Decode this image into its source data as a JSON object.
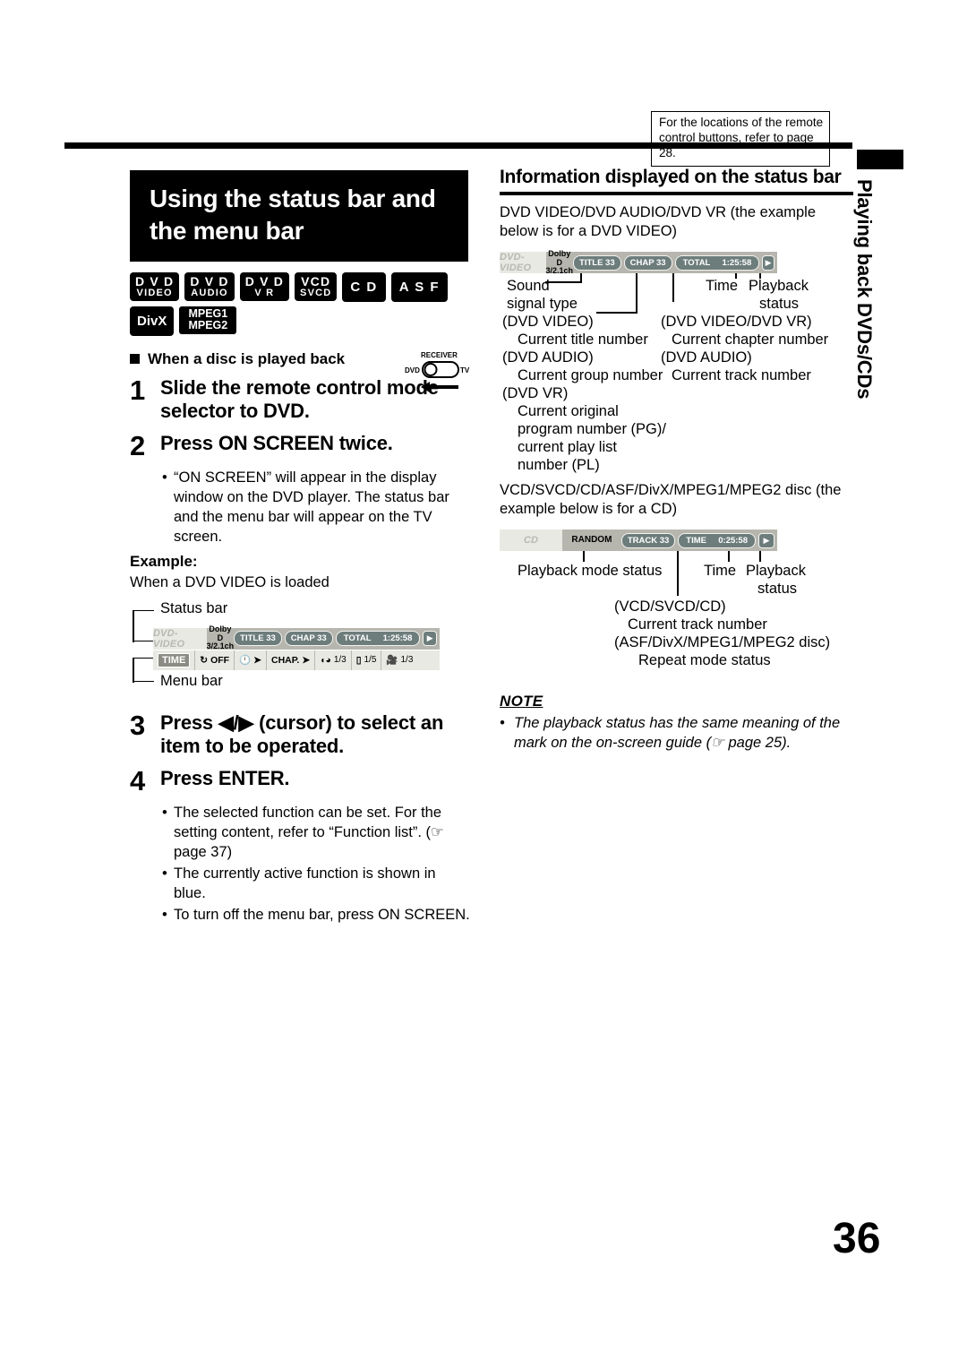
{
  "remote_note": "For the locations of the remote control buttons, refer to page 28.",
  "side_tab": {
    "label": "Playing back DVDs/CDs"
  },
  "page_number": "36",
  "left": {
    "title": "Using the status bar and the menu bar",
    "logos": [
      {
        "line1": "D V D",
        "line2": "VIDEO"
      },
      {
        "line1": "D V D",
        "line2": "AUDIO"
      },
      {
        "line1": "D V D",
        "line2": "V R"
      },
      {
        "line1": "VCD",
        "line2": "SVCD"
      },
      {
        "line1": "C D",
        "line2": ""
      },
      {
        "line1": "A S F",
        "line2": ""
      },
      {
        "line1": "DivX",
        "line2": ""
      },
      {
        "line1": "MPEG1",
        "line2": "MPEG2"
      }
    ],
    "subhead": "When a disc is played back",
    "steps": [
      {
        "num": "1",
        "text": "Slide the remote control mode selector to DVD."
      },
      {
        "num": "2",
        "text": "Press ON SCREEN twice."
      },
      {
        "num": "3",
        "text": "Press ◀/▶ (cursor) to select an item to be operated."
      },
      {
        "num": "4",
        "text": "Press ENTER."
      }
    ],
    "step2_bullets": [
      "“ON SCREEN” will appear in the display window on the DVD player. The status bar and the menu bar will appear on the TV screen."
    ],
    "example_label": "Example:",
    "example_text": "When a DVD VIDEO is loaded",
    "step4_bullets": [
      "The selected function can be set. For the setting content, refer to “Function list”. (☞ page 37)",
      "The currently active function is shown in blue.",
      "To turn off the menu bar, press ON SCREEN."
    ],
    "figure": {
      "status_bar_label": "Status bar",
      "menu_bar_label": "Menu bar",
      "status_bar": {
        "disc": "DVD-VIDEO",
        "sound_line1": "Dolby D",
        "sound_line2": "3/2.1ch",
        "chips": [
          "TITLE 33",
          "CHAP 33"
        ],
        "total_label": "TOTAL",
        "total_value": "1:25:58",
        "play_icon": "play-icon"
      },
      "menu_bar": {
        "time_label": "TIME",
        "repeat_label": "OFF",
        "chapter_label": "CHAP.",
        "audio_value": "1/3",
        "subtitle_value": "1/5",
        "angle_value": "1/3"
      }
    },
    "remote_selector": {
      "top": "RECEIVER",
      "left": "DVD",
      "right": "TV"
    }
  },
  "right": {
    "heading": "Information displayed on the status bar",
    "intro": "DVD VIDEO/DVD AUDIO/DVD VR (the example below is for a DVD VIDEO)",
    "dvd_status_bar": {
      "disc": "DVD-VIDEO",
      "sound_line1": "Dolby D",
      "sound_line2": "3/2.1ch",
      "chips": [
        "TITLE 33",
        "CHAP 33"
      ],
      "total_label": "TOTAL",
      "total_value": "1:25:58",
      "play_icon": "play-icon"
    },
    "dvd_callouts": {
      "sound_1": "Sound",
      "sound_2": "signal type",
      "time": "Time",
      "playback_1": "Playback",
      "playback_2": "status",
      "left_group": [
        "(DVD VIDEO)",
        "Current title number",
        "(DVD AUDIO)",
        "Current group number",
        "(DVD VR)",
        "Current original",
        "program number (PG)/",
        "current play list",
        "number (PL)"
      ],
      "right_group": [
        "(DVD VIDEO/DVD VR)",
        "Current chapter number",
        "(DVD AUDIO)",
        "Current track number"
      ]
    },
    "cd_intro": "VCD/SVCD/CD/ASF/DivX/MPEG1/MPEG2 disc (the example below is for a CD)",
    "cd_status_bar": {
      "disc": "CD",
      "mode": "RANDOM",
      "track": "TRACK 33",
      "time_label": "TIME",
      "time_value": "0:25:58",
      "play_icon": "play-icon"
    },
    "cd_callouts": {
      "playback_mode": "Playback mode status",
      "time": "Time",
      "playback_1": "Playback",
      "playback_2": "status",
      "group": [
        "(VCD/SVCD/CD)",
        "Current track number",
        "(ASF/DivX/MPEG1/MPEG2 disc)",
        "Repeat mode status"
      ]
    },
    "note_heading": "NOTE",
    "note_bullet": "The playback status has the same meaning of the mark on the on-screen guide (☞ page 25)."
  },
  "colors": {
    "statusbar_bg": "#b6b6ae",
    "disc_bg": "#e9e9e4",
    "chip_bg": "#6d7d7b",
    "menubar_bg": "#e9e9e4"
  }
}
